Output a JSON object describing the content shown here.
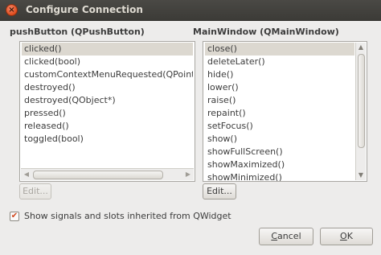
{
  "window": {
    "title": "Configure Connection"
  },
  "signals": {
    "header": "pushButton (QPushButton)",
    "items": [
      "clicked()",
      "clicked(bool)",
      "customContextMenuRequested(QPoint)",
      "destroyed()",
      "destroyed(QObject*)",
      "pressed()",
      "released()",
      "toggled(bool)"
    ],
    "selected_index": 0,
    "edit_label": "Edit..."
  },
  "slots": {
    "header": "MainWindow (QMainWindow)",
    "items": [
      "close()",
      "deleteLater()",
      "hide()",
      "lower()",
      "raise()",
      "repaint()",
      "setFocus()",
      "show()",
      "showFullScreen()",
      "showMaximized()",
      "showMinimized()"
    ],
    "selected_index": 0,
    "edit_label": "Edit..."
  },
  "inherit_option": {
    "label": "Show signals and slots inherited from QWidget",
    "checked": true
  },
  "buttons": {
    "cancel_first": "C",
    "cancel_rest": "ancel",
    "ok_first": "O",
    "ok_rest": "K"
  },
  "icons": {
    "close": "close-icon",
    "check": "check-icon",
    "scroll_left": "arrow-left-icon",
    "scroll_right": "arrow-right-icon",
    "scroll_up": "arrow-up-icon",
    "scroll_down": "arrow-down-icon"
  }
}
